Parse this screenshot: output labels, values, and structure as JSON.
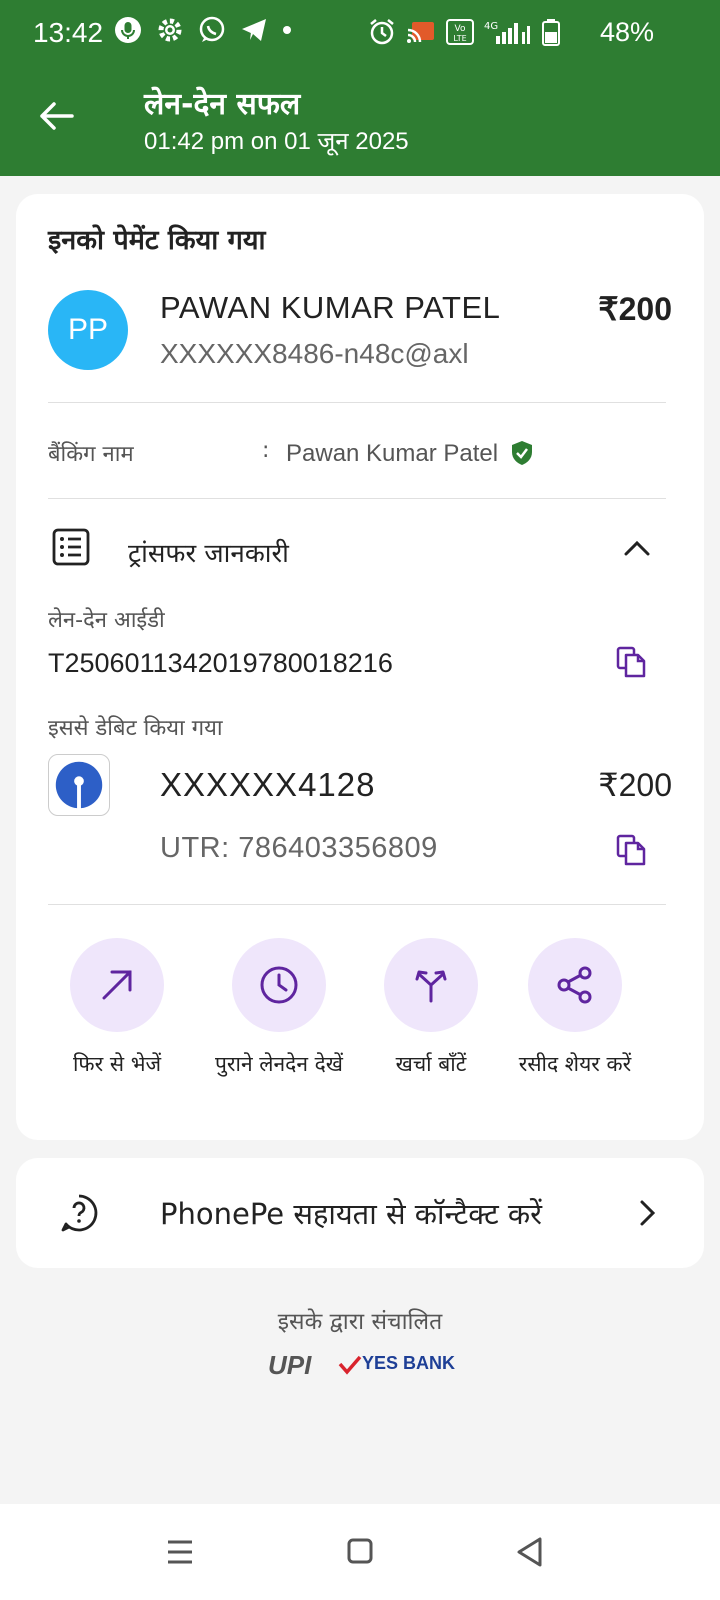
{
  "status_bar": {
    "time": "13:42",
    "battery": "48%",
    "network": "4G"
  },
  "header": {
    "title": "लेन-देन सफल",
    "subtitle": "01:42 pm on 01 जून 2025"
  },
  "payee": {
    "section_title": "इनको पेमेंट किया गया",
    "initials": "PP",
    "name": "PAWAN KUMAR PATEL",
    "upi_id": "XXXXXX8486-n48c@axl",
    "amount": "₹200",
    "banking_name_label": "बैंकिंग नाम",
    "colon": ":",
    "banking_name": "Pawan Kumar Patel"
  },
  "transfer": {
    "title": "ट्रांसफर जानकारी",
    "txn_id_label": "लेन-देन आईडी",
    "txn_id": "T2506011342019780018216",
    "debited_label": "इससे डेबिट किया गया",
    "account": "XXXXXX4128",
    "account_amount": "₹200",
    "utr": "UTR: 786403356809"
  },
  "actions": [
    {
      "label": "फिर से भेजें",
      "icon": "arrow-up-right-icon"
    },
    {
      "label": "पुराने लेनदेन देखें",
      "icon": "clock-icon"
    },
    {
      "label": "खर्चा बाँटें",
      "icon": "split-icon"
    },
    {
      "label": "रसीद शेयर करें",
      "icon": "share-icon"
    }
  ],
  "support": {
    "label": "PhonePe सहायता से कॉन्टैक्ट करें"
  },
  "footer": {
    "powered_by": "इसके द्वारा संचालित",
    "upi_logo": "UPI",
    "bank_logo": "YES BANK"
  },
  "colors": {
    "header_green": "#2e7d32",
    "accent_purple": "#5f259f",
    "avatar_blue": "#29b6f6",
    "action_bg": "#efe6fb"
  }
}
